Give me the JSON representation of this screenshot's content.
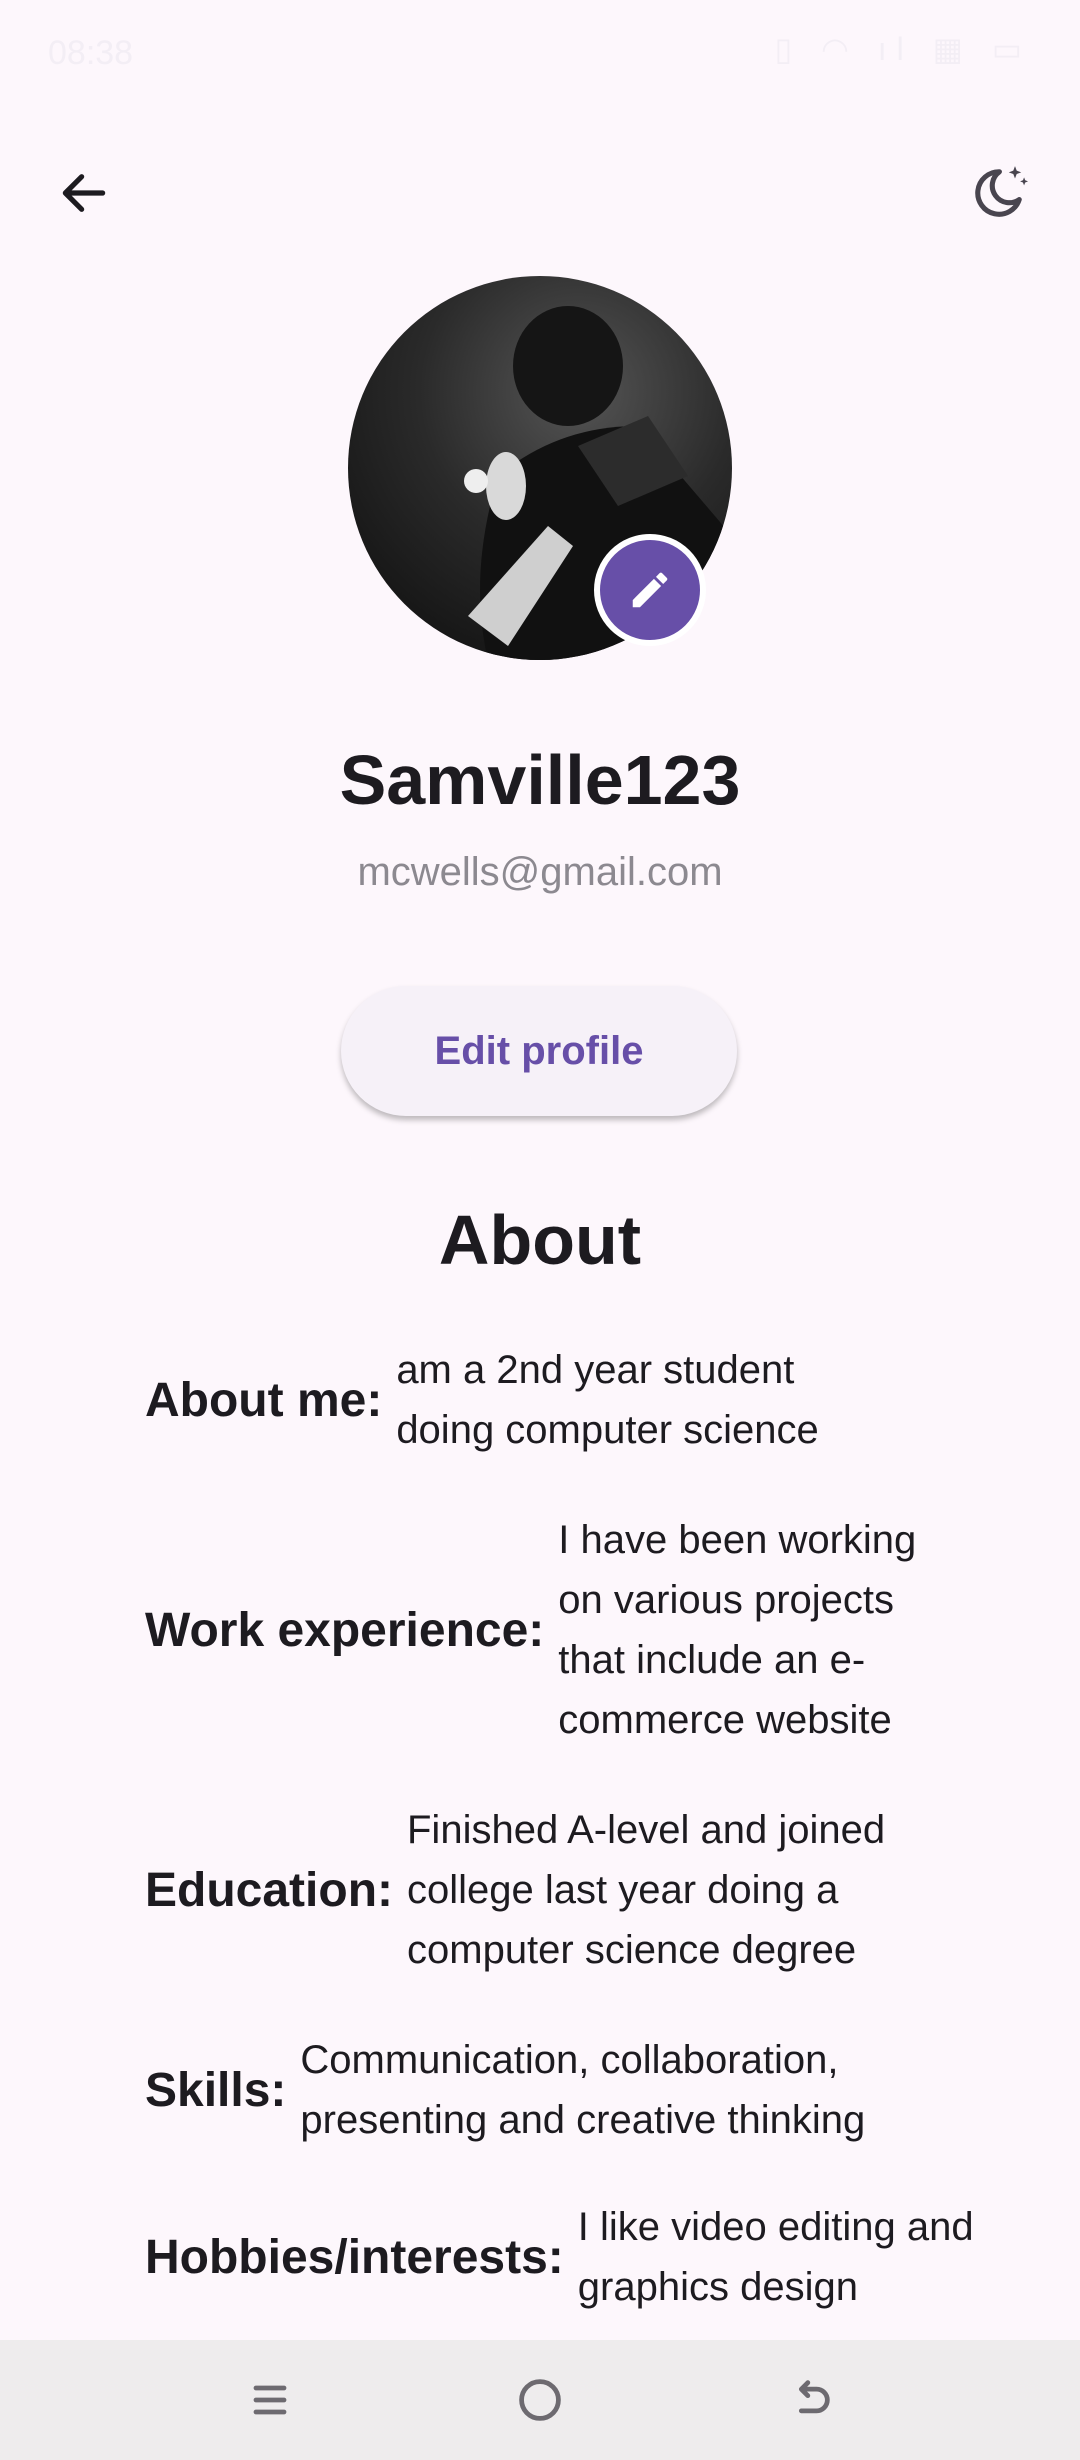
{
  "status_bar": {
    "time": "08:38",
    "icons": "▯ ◠ ıl ▦ ▭"
  },
  "profile": {
    "username": "Samville123",
    "email": "mcwells@gmail.com",
    "edit_profile_label": "Edit profile"
  },
  "about": {
    "heading": "About",
    "rows": [
      {
        "label": "About me:",
        "value": "am a 2nd year student doing computer science"
      },
      {
        "label": "Work experience:",
        "value": "I have been working on various projects that include an e-commerce website"
      },
      {
        "label": "Education:",
        "value": "Finished A-level and joined college last year doing a computer science degree"
      },
      {
        "label": "Skills:",
        "value": "Communication, collaboration, presenting and creative thinking"
      },
      {
        "label": "Hobbies/interests:",
        "value": "I like video editing and graphics design"
      }
    ]
  },
  "colors": {
    "accent": "#674fa8",
    "background": "#fdf7fc",
    "nav_bar": "#eeeced"
  },
  "icons": [
    "back-arrow-icon",
    "dark-mode-moon-icon",
    "pencil-icon",
    "menu-icon",
    "home-icon",
    "back-icon"
  ]
}
